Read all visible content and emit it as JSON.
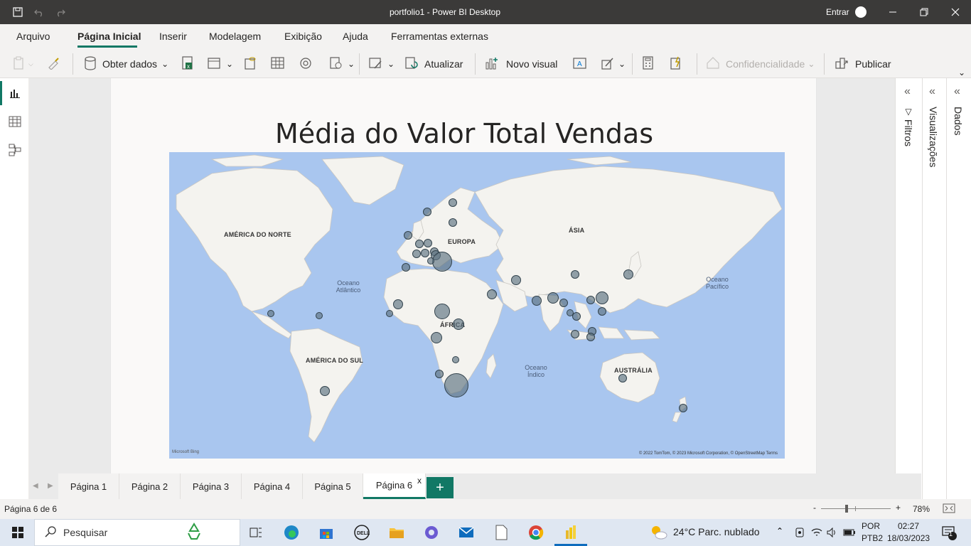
{
  "window": {
    "title": "portfolio1 - Power BI Desktop",
    "signin_label": "Entrar"
  },
  "menu": {
    "tabs": [
      "Arquivo",
      "Página Inicial",
      "Inserir",
      "Modelagem",
      "Exibição",
      "Ajuda",
      "Ferramentas externas"
    ],
    "active": "Página Inicial"
  },
  "ribbon": {
    "get_data": "Obter dados",
    "refresh": "Atualizar",
    "new_visual": "Novo visual",
    "sensitivity": "Confidencialidade",
    "publish": "Publicar"
  },
  "visual": {
    "title": "Média do Valor Total Vendas",
    "continents": {
      "north_america": "AMÉRICA DO NORTE",
      "south_america": "AMÉRICA DO SUL",
      "europe": "EUROPA",
      "asia": "ÁSIA",
      "africa": "ÁFRICA",
      "australia": "AUSTRÁLIA"
    },
    "oceans": {
      "atlantic": "Oceano Atlântico",
      "pacific": "Oceano Pacífico",
      "indian": "Oceano Índico"
    },
    "attribution": "© 2022 TomTom, © 2023 Microsoft Corporation, © OpenStreetMap  Terms",
    "bing_logo": "Microsoft Bing",
    "bubble_color": "#5c7280"
  },
  "panes": {
    "filters": "Filtros",
    "visualizations": "Visualizações",
    "data": "Dados"
  },
  "pages": {
    "tabs": [
      "Página 1",
      "Página 2",
      "Página 3",
      "Página 4",
      "Página 5",
      "Página 6"
    ],
    "active": "Página 6",
    "close_glyph": "x",
    "add_glyph": "+"
  },
  "status": {
    "page_indicator": "Página 6 de 6",
    "zoom_minus": "-",
    "zoom_plus": "+",
    "zoom": "78%"
  },
  "taskbar": {
    "search_placeholder": "Pesquisar",
    "weather": "24°C  Parc. nublado",
    "lang1": "POR",
    "lang2": "PTB2",
    "time": "02:27",
    "date": "18/03/2023",
    "notifications": "1"
  }
}
